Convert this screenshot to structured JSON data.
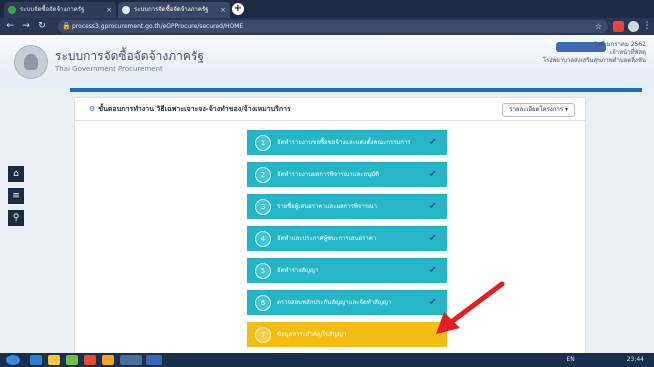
{
  "browser": {
    "tabs": [
      {
        "label": "ระบบจัดซื้อจัดจ้างภาครัฐ",
        "active": false
      },
      {
        "label": "ระบบการจัดซื้อจัดจ้างภาครัฐ",
        "active": true
      }
    ],
    "url": "process3.gprocurement.go.th/eGPProcure/secured/HOME"
  },
  "site": {
    "title": "ระบบการจัดซื้อจัดจ้างภาครัฐ",
    "subtitle": "Thai Government Procurement",
    "user_date": "วันที่ มกราคม 2562",
    "user_role": "เจ้าหน้าที่พัสดุ",
    "user_org": "โรงพยาบาลส่งเสริมสุขภาพตำบลตลิ่งชัน"
  },
  "panel": {
    "title": "ขั้นตอนการทำงาน วิธีเฉพาะเจาะจง-จ้างทำของ/จ้างเหมาบริการ",
    "detail_button": "รายละเอียดโครงการ ▾"
  },
  "steps": [
    {
      "num": "1",
      "label": "จัดทำรายงานขอซื้อขอจ้างและแต่งตั้งคณะกรรมการ",
      "done": true
    },
    {
      "num": "2",
      "label": "จัดทำรายงานผลการพิจารณาและอนุมัติ",
      "done": true
    },
    {
      "num": "3",
      "label": "รายชื่อผู้เสนอราคาและผลการพิจารณา",
      "done": true
    },
    {
      "num": "4",
      "label": "จัดทำและประกาศผู้ชนะการเสนอราคา",
      "done": true
    },
    {
      "num": "5",
      "label": "จัดทำร่างสัญญา",
      "done": true
    },
    {
      "num": "6",
      "label": "ตรวจสอบหลักประกันสัญญาและจัดทำสัญญา",
      "done": true
    },
    {
      "num": "7",
      "label": "ข้อมูลสาระสำคัญในสัญญา",
      "done": false
    }
  ],
  "icons": {
    "check": "✔",
    "home": "⌂",
    "menu": "≡",
    "search": "⚲"
  },
  "taskbar": {
    "time": "23:44",
    "lang": "EN"
  },
  "colors": {
    "step_done": "#25b5c7",
    "step_current": "#f3bd13",
    "header_bar": "#1d6fb8",
    "arrow": "#e02020"
  }
}
